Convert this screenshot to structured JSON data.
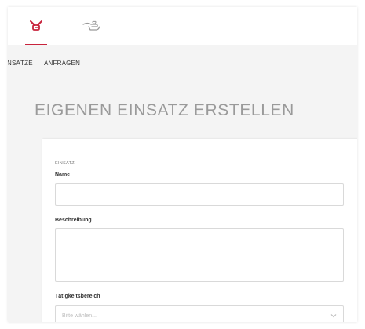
{
  "colors": {
    "accent": "#c8233c",
    "icon_gray": "#999999"
  },
  "topbar": {
    "tabs": [
      {
        "icon": "pager-icon",
        "active": true
      },
      {
        "icon": "hands-heart-icon",
        "active": false
      }
    ]
  },
  "subnav": {
    "items": [
      "NSÄTZE",
      "ANFRAGEN"
    ]
  },
  "page": {
    "title": "EIGENEN EINSATZ ERSTELLEN"
  },
  "form": {
    "section": "EINSATZ",
    "name_label": "Name",
    "name_value": "",
    "description_label": "Beschreibung",
    "description_value": "",
    "area_label": "Tätigkeitsbereich",
    "area_placeholder": "Bitte wählen..."
  }
}
